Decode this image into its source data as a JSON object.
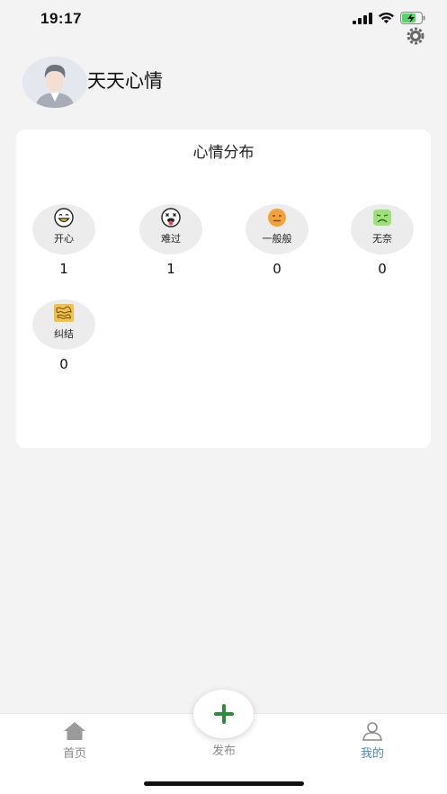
{
  "status_bar": {
    "time": "19:17"
  },
  "profile": {
    "name": "天天心情"
  },
  "card": {
    "title": "心情分布",
    "moods": [
      {
        "label": "开心",
        "count": "1",
        "icon": "grin-emoji-icon"
      },
      {
        "label": "难过",
        "count": "1",
        "icon": "tongue-sad-emoji-icon"
      },
      {
        "label": "一般般",
        "count": "0",
        "icon": "neutral-emoji-icon"
      },
      {
        "label": "无奈",
        "count": "0",
        "icon": "helpless-green-emoji-icon"
      },
      {
        "label": "纠结",
        "count": "0",
        "icon": "tangled-emoji-icon"
      }
    ]
  },
  "tabs": {
    "home": "首页",
    "publish": "发布",
    "mine": "我的"
  },
  "colors": {
    "active_tab": "#4a86c9",
    "publish_plus": "#2e8b3e"
  }
}
